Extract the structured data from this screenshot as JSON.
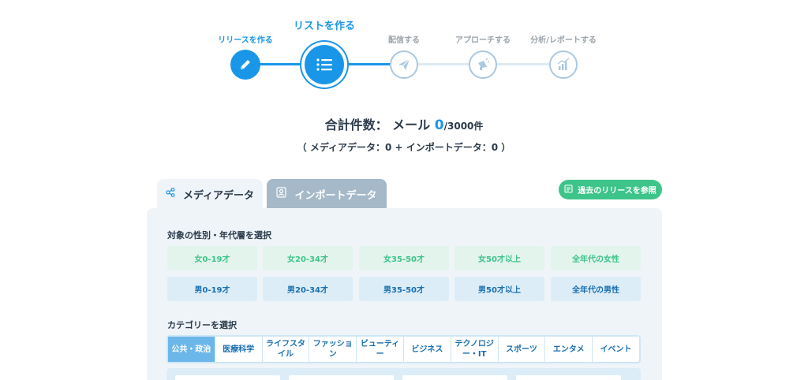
{
  "stepper": {
    "steps": [
      {
        "label": "リリースを作る",
        "state": "done",
        "icon": "pencil-icon"
      },
      {
        "label": "リストを作る",
        "state": "current",
        "icon": "list-icon"
      },
      {
        "label": "配信する",
        "state": "todo",
        "icon": "paper-plane-icon"
      },
      {
        "label": "アプローチする",
        "state": "todo",
        "icon": "megaphone-icon"
      },
      {
        "label": "分析/レポートする",
        "state": "todo",
        "icon": "bar-chart-icon"
      }
    ]
  },
  "totals": {
    "prefix": "合計件数：",
    "type": "メール",
    "count": "0",
    "max": "/3000件",
    "breakdown": "（ メディアデータ：0 + インポートデータ：0 ）"
  },
  "tabs": {
    "media": "メディアデータ",
    "import": "インポートデータ",
    "history_button": "過去のリリースを参照"
  },
  "gender_section": {
    "title": "対象の性別・年代層を選択",
    "female": [
      "女0-19才",
      "女20-34才",
      "女35-50才",
      "女50才以上",
      "全年代の女性"
    ],
    "male": [
      "男0-19才",
      "男20-34才",
      "男35-50才",
      "男50才以上",
      "全年代の男性"
    ]
  },
  "category_section": {
    "title": "カテゴリーを選択",
    "items": [
      {
        "label": "公共・政治",
        "active": true
      },
      {
        "label": "医療科学",
        "active": false
      },
      {
        "label": "ライフスタイル",
        "active": false
      },
      {
        "label": "ファッション",
        "active": false
      },
      {
        "label": "ビューティー",
        "active": false
      },
      {
        "label": "ビジネス",
        "active": false
      },
      {
        "label": "テクノロジー・IT",
        "active": false
      },
      {
        "label": "スポーツ",
        "active": false
      },
      {
        "label": "エンタメ",
        "active": false
      },
      {
        "label": "イベント",
        "active": false
      }
    ]
  },
  "colors": {
    "primary": "#1a96e8",
    "success": "#3dc48a",
    "tab_inactive": "#a5b9c9",
    "panel_bg": "#eef4f8"
  }
}
